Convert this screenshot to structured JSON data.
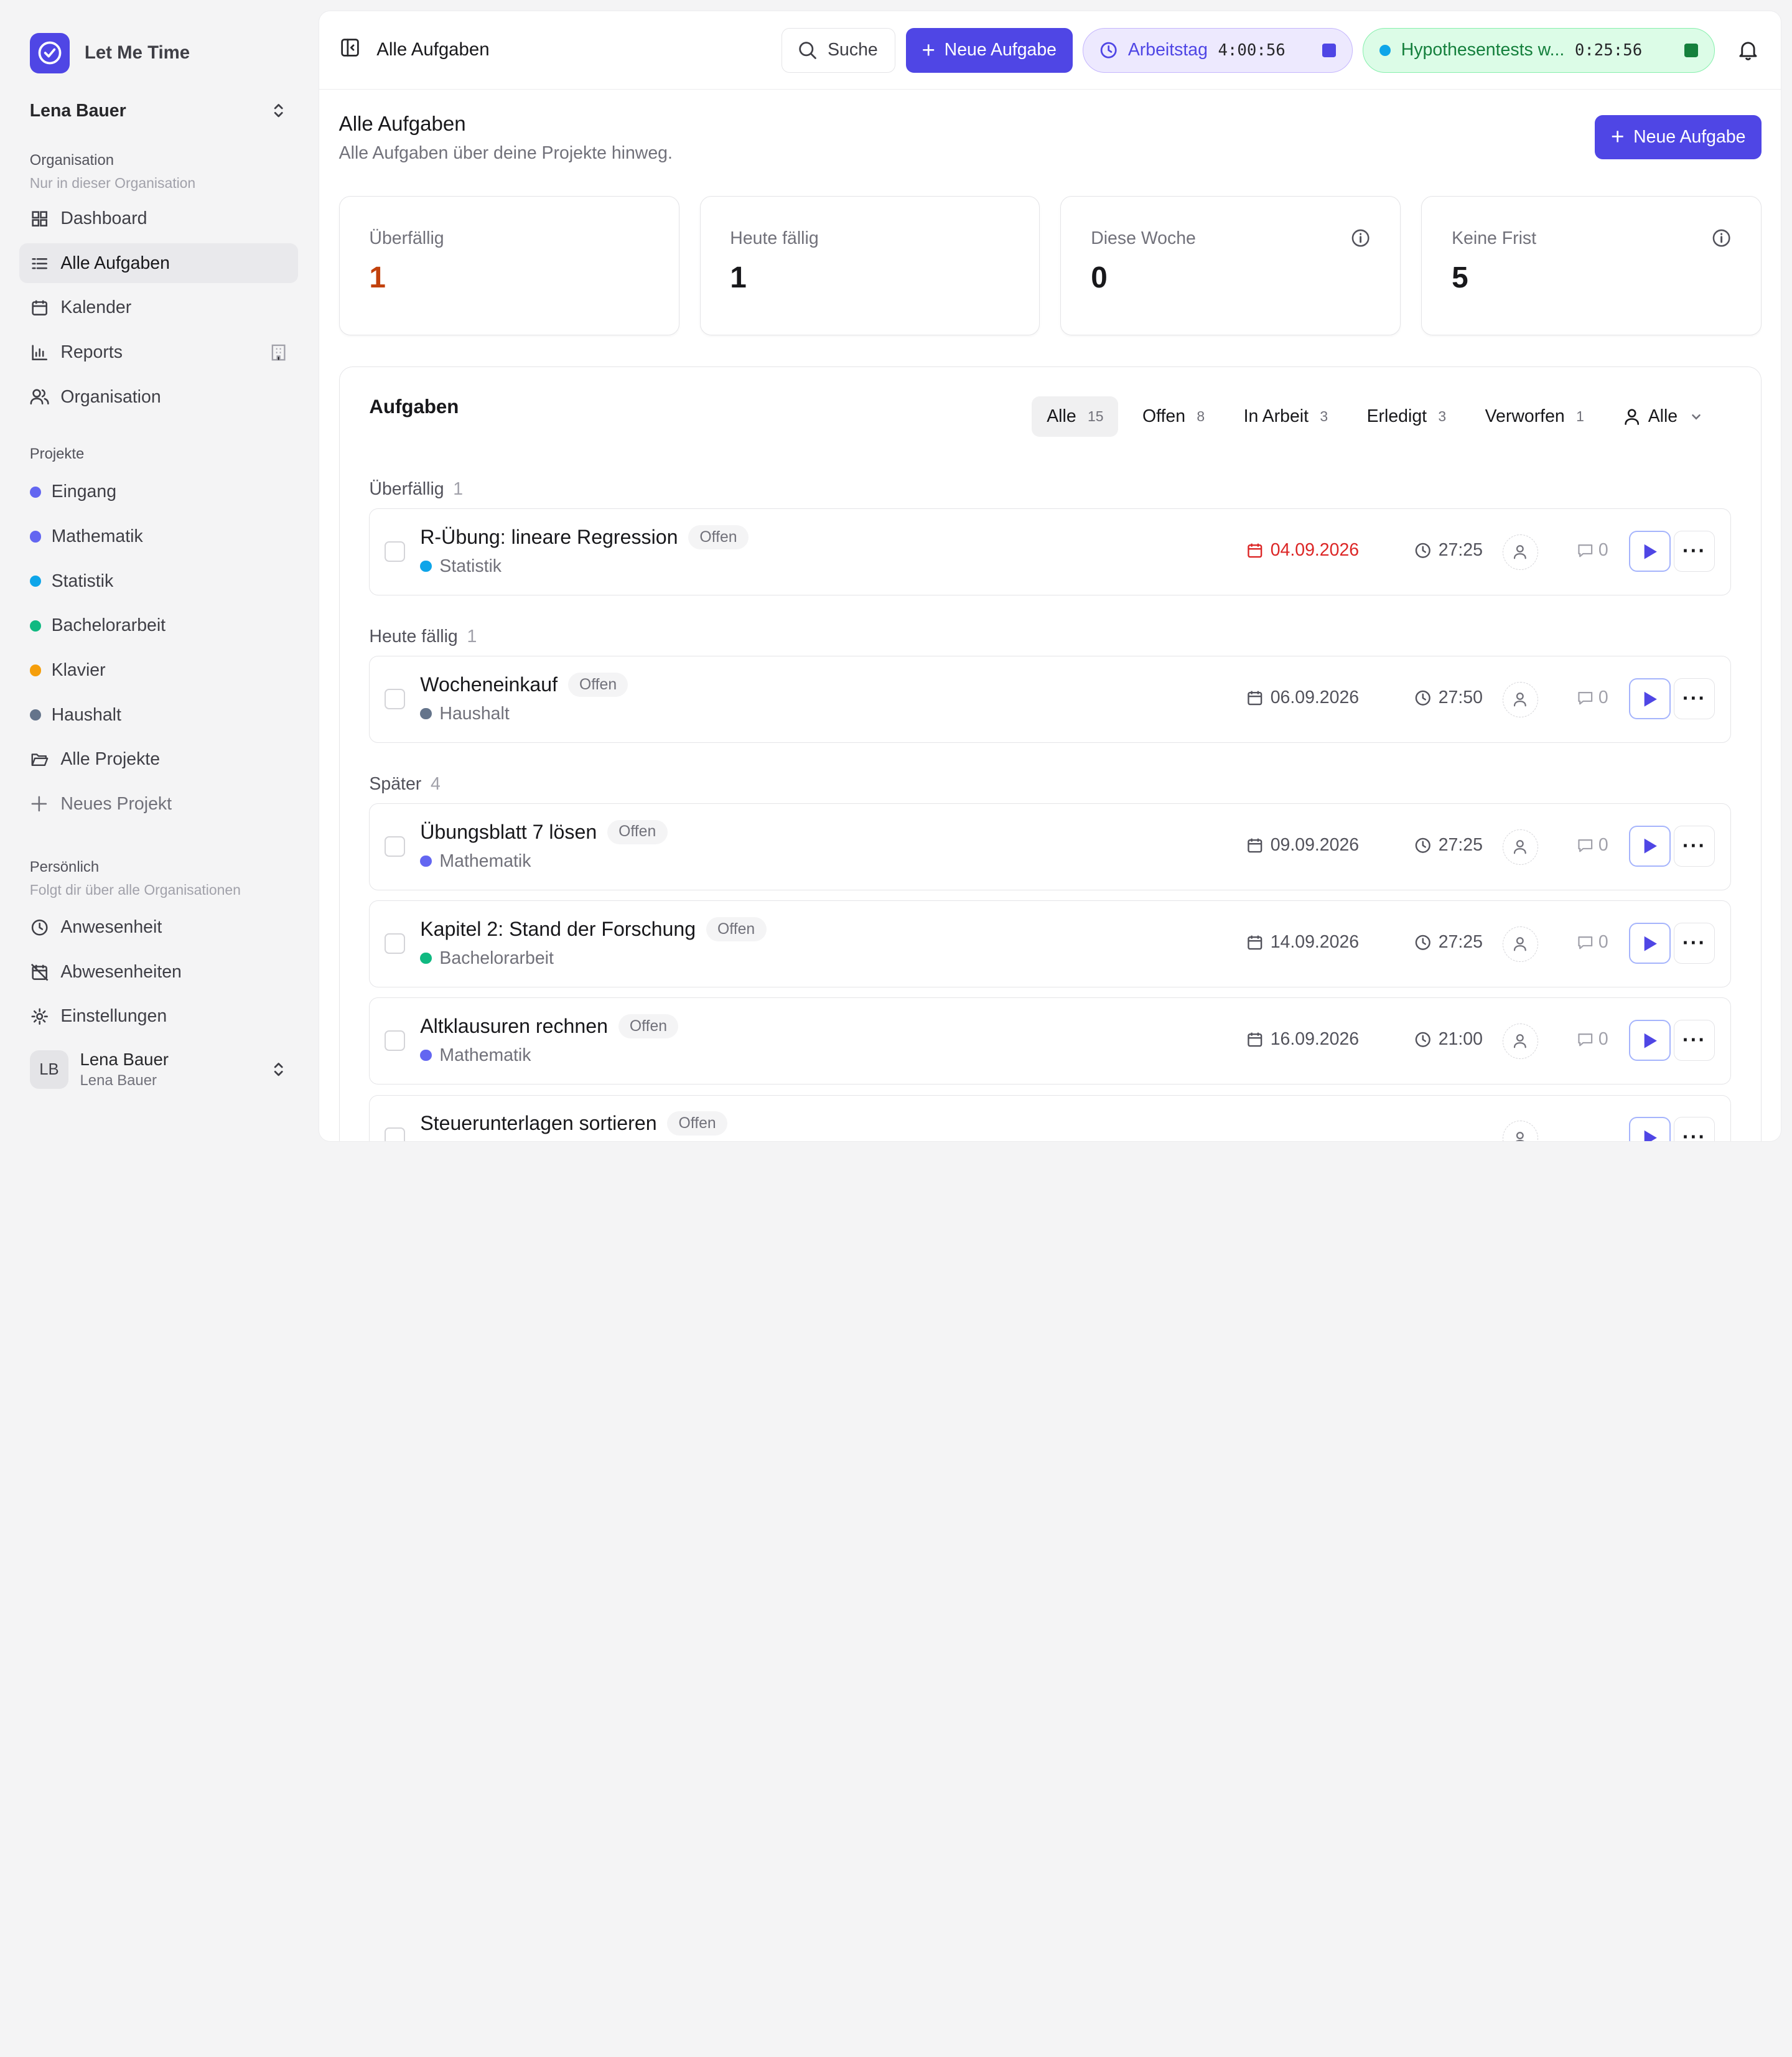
{
  "app": {
    "name": "Let Me Time"
  },
  "sidebar": {
    "org_switcher": "Lena Bauer",
    "org_section": {
      "title": "Organisation",
      "subtitle": "Nur in dieser Organisation"
    },
    "nav": [
      {
        "label": "Dashboard",
        "icon": "grid-icon"
      },
      {
        "label": "Alle Aufgaben",
        "icon": "list-icon",
        "active": true
      },
      {
        "label": "Kalender",
        "icon": "calendar-icon"
      },
      {
        "label": "Reports",
        "icon": "bar-chart-icon"
      },
      {
        "label": "Organisation",
        "icon": "users-icon"
      }
    ],
    "projects_title": "Projekte",
    "projects": [
      {
        "label": "Eingang",
        "color": "#6366f1"
      },
      {
        "label": "Mathematik",
        "color": "#6366f1"
      },
      {
        "label": "Statistik",
        "color": "#0ea5e9"
      },
      {
        "label": "Bachelorarbeit",
        "color": "#10b981"
      },
      {
        "label": "Klavier",
        "color": "#f59e0b"
      },
      {
        "label": "Haushalt",
        "color": "#64748b"
      }
    ],
    "all_projects": "Alle Projekte",
    "new_project": "Neues Projekt",
    "personal_section": {
      "title": "Persönlich",
      "subtitle": "Folgt dir über alle Organisationen"
    },
    "personal_nav": [
      {
        "label": "Anwesenheit",
        "icon": "clock-icon"
      },
      {
        "label": "Abwesenheiten",
        "icon": "calendar-off-icon"
      },
      {
        "label": "Einstellungen",
        "icon": "gear-icon"
      }
    ],
    "footer": {
      "initials": "LB",
      "name": "Lena Bauer",
      "sub": "Lena Bauer"
    }
  },
  "topbar": {
    "breadcrumb": "Alle Aufgaben",
    "search_label": "Suche",
    "new_task": "Neue Aufgabe",
    "work_timer": {
      "label": "Arbeitstag",
      "time": "4:00:56"
    },
    "task_timer": {
      "label": "Hypothesentests w...",
      "time": "0:25:56"
    }
  },
  "page": {
    "title": "Alle Aufgaben",
    "subtitle": "Alle Aufgaben über deine Projekte hinweg.",
    "new_task": "Neue Aufgabe"
  },
  "stats": [
    {
      "label": "Überfällig",
      "value": "1",
      "accent": "#c2410c"
    },
    {
      "label": "Heute fällig",
      "value": "1"
    },
    {
      "label": "Diese Woche",
      "value": "0",
      "info": true
    },
    {
      "label": "Keine Frist",
      "value": "5",
      "info": true
    }
  ],
  "tasks": {
    "title": "Aufgaben",
    "filters": [
      {
        "label": "Alle",
        "count": "15",
        "active": true
      },
      {
        "label": "Offen",
        "count": "8"
      },
      {
        "label": "In Arbeit",
        "count": "3"
      },
      {
        "label": "Erledigt",
        "count": "3"
      },
      {
        "label": "Verworfen",
        "count": "1"
      }
    ],
    "assignee_filter": "Alle",
    "groups": [
      {
        "label": "Überfällig",
        "count": "1",
        "items": [
          {
            "title": "R-Übung: lineare Regression",
            "status": "Offen",
            "project": "Statistik",
            "color": "#0ea5e9",
            "date": "04.09.2026",
            "late": true,
            "duration": "27:25",
            "comments": "0"
          }
        ]
      },
      {
        "label": "Heute fällig",
        "count": "1",
        "items": [
          {
            "title": "Wocheneinkauf",
            "status": "Offen",
            "project": "Haushalt",
            "color": "#64748b",
            "date": "06.09.2026",
            "late": false,
            "duration": "27:50",
            "comments": "0"
          }
        ]
      },
      {
        "label": "Später",
        "count": "4",
        "items": [
          {
            "title": "Übungsblatt 7 lösen",
            "status": "Offen",
            "project": "Mathematik",
            "color": "#6366f1",
            "date": "09.09.2026",
            "late": false,
            "duration": "27:25",
            "comments": "0"
          },
          {
            "title": "Kapitel 2: Stand der Forschung",
            "status": "Offen",
            "project": "Bachelorarbeit",
            "color": "#10b981",
            "date": "14.09.2026",
            "late": false,
            "duration": "27:25",
            "comments": "0"
          },
          {
            "title": "Altklausuren rechnen",
            "status": "Offen",
            "project": "Mathematik",
            "color": "#6366f1",
            "date": "16.09.2026",
            "late": false,
            "duration": "21:00",
            "comments": "0"
          },
          {
            "title": "Steuerunterlagen sortieren",
            "status": "Offen",
            "project": "",
            "color": "#64748b",
            "date": "",
            "late": false,
            "duration": "",
            "comments": ""
          }
        ]
      }
    ]
  }
}
